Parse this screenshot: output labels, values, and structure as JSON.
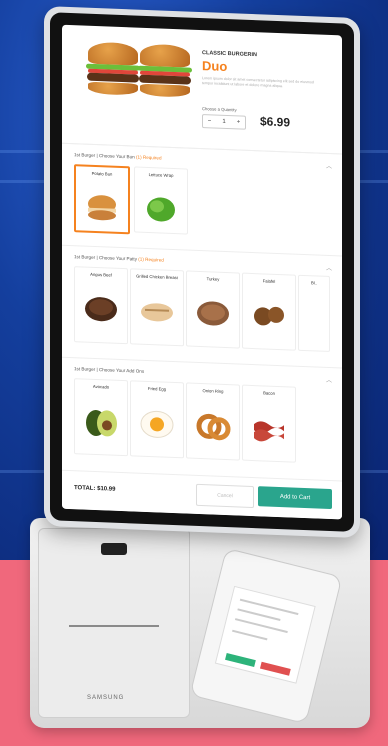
{
  "product": {
    "category": "CLASSIC BURGERIN",
    "name": "Duo",
    "description": "Lorem ipsum dolor sit amet consectetur adipiscing elit sed do eiusmod tempor incididunt ut labore et dolore magna aliqua.",
    "quantity_label": "Choose a Quantity",
    "quantity": "1",
    "price": "$6.99"
  },
  "sections": [
    {
      "header": "1st Burger | Choose Your Bun",
      "required": "(1) Required",
      "options": [
        {
          "label": "Potato Bun",
          "icon": "bun-icon"
        },
        {
          "label": "Lettuce Wrap",
          "icon": "lettuce-icon"
        }
      ]
    },
    {
      "header": "1st Burger | Choose Your Patty",
      "required": "(1) Required",
      "options": [
        {
          "label": "Angus Beef",
          "icon": "beef-patty-icon"
        },
        {
          "label": "Grilled Chicken Breast",
          "icon": "chicken-icon"
        },
        {
          "label": "Turkey",
          "icon": "turkey-patty-icon"
        },
        {
          "label": "Falafel",
          "icon": "falafel-icon"
        },
        {
          "label": "Bl..",
          "icon": "patty-icon"
        }
      ]
    },
    {
      "header": "1st Burger | Choose Your Add Ons",
      "required": "",
      "options": [
        {
          "label": "Avocado",
          "icon": "avocado-icon"
        },
        {
          "label": "Fried Egg",
          "icon": "egg-icon"
        },
        {
          "label": "Onion Ring",
          "icon": "onion-ring-icon"
        },
        {
          "label": "Bacon",
          "icon": "bacon-icon"
        }
      ]
    }
  ],
  "footer": {
    "total": "TOTAL: $10.99",
    "cancel_label": "Cancel",
    "cart_label": "Add to Cart"
  },
  "hardware": {
    "brand": "SAMSUNG"
  },
  "colors": {
    "accent": "#f5821f",
    "cart_button": "#2aa58d",
    "background_pink": "#f0687c",
    "background_blue": "#143f9e"
  }
}
